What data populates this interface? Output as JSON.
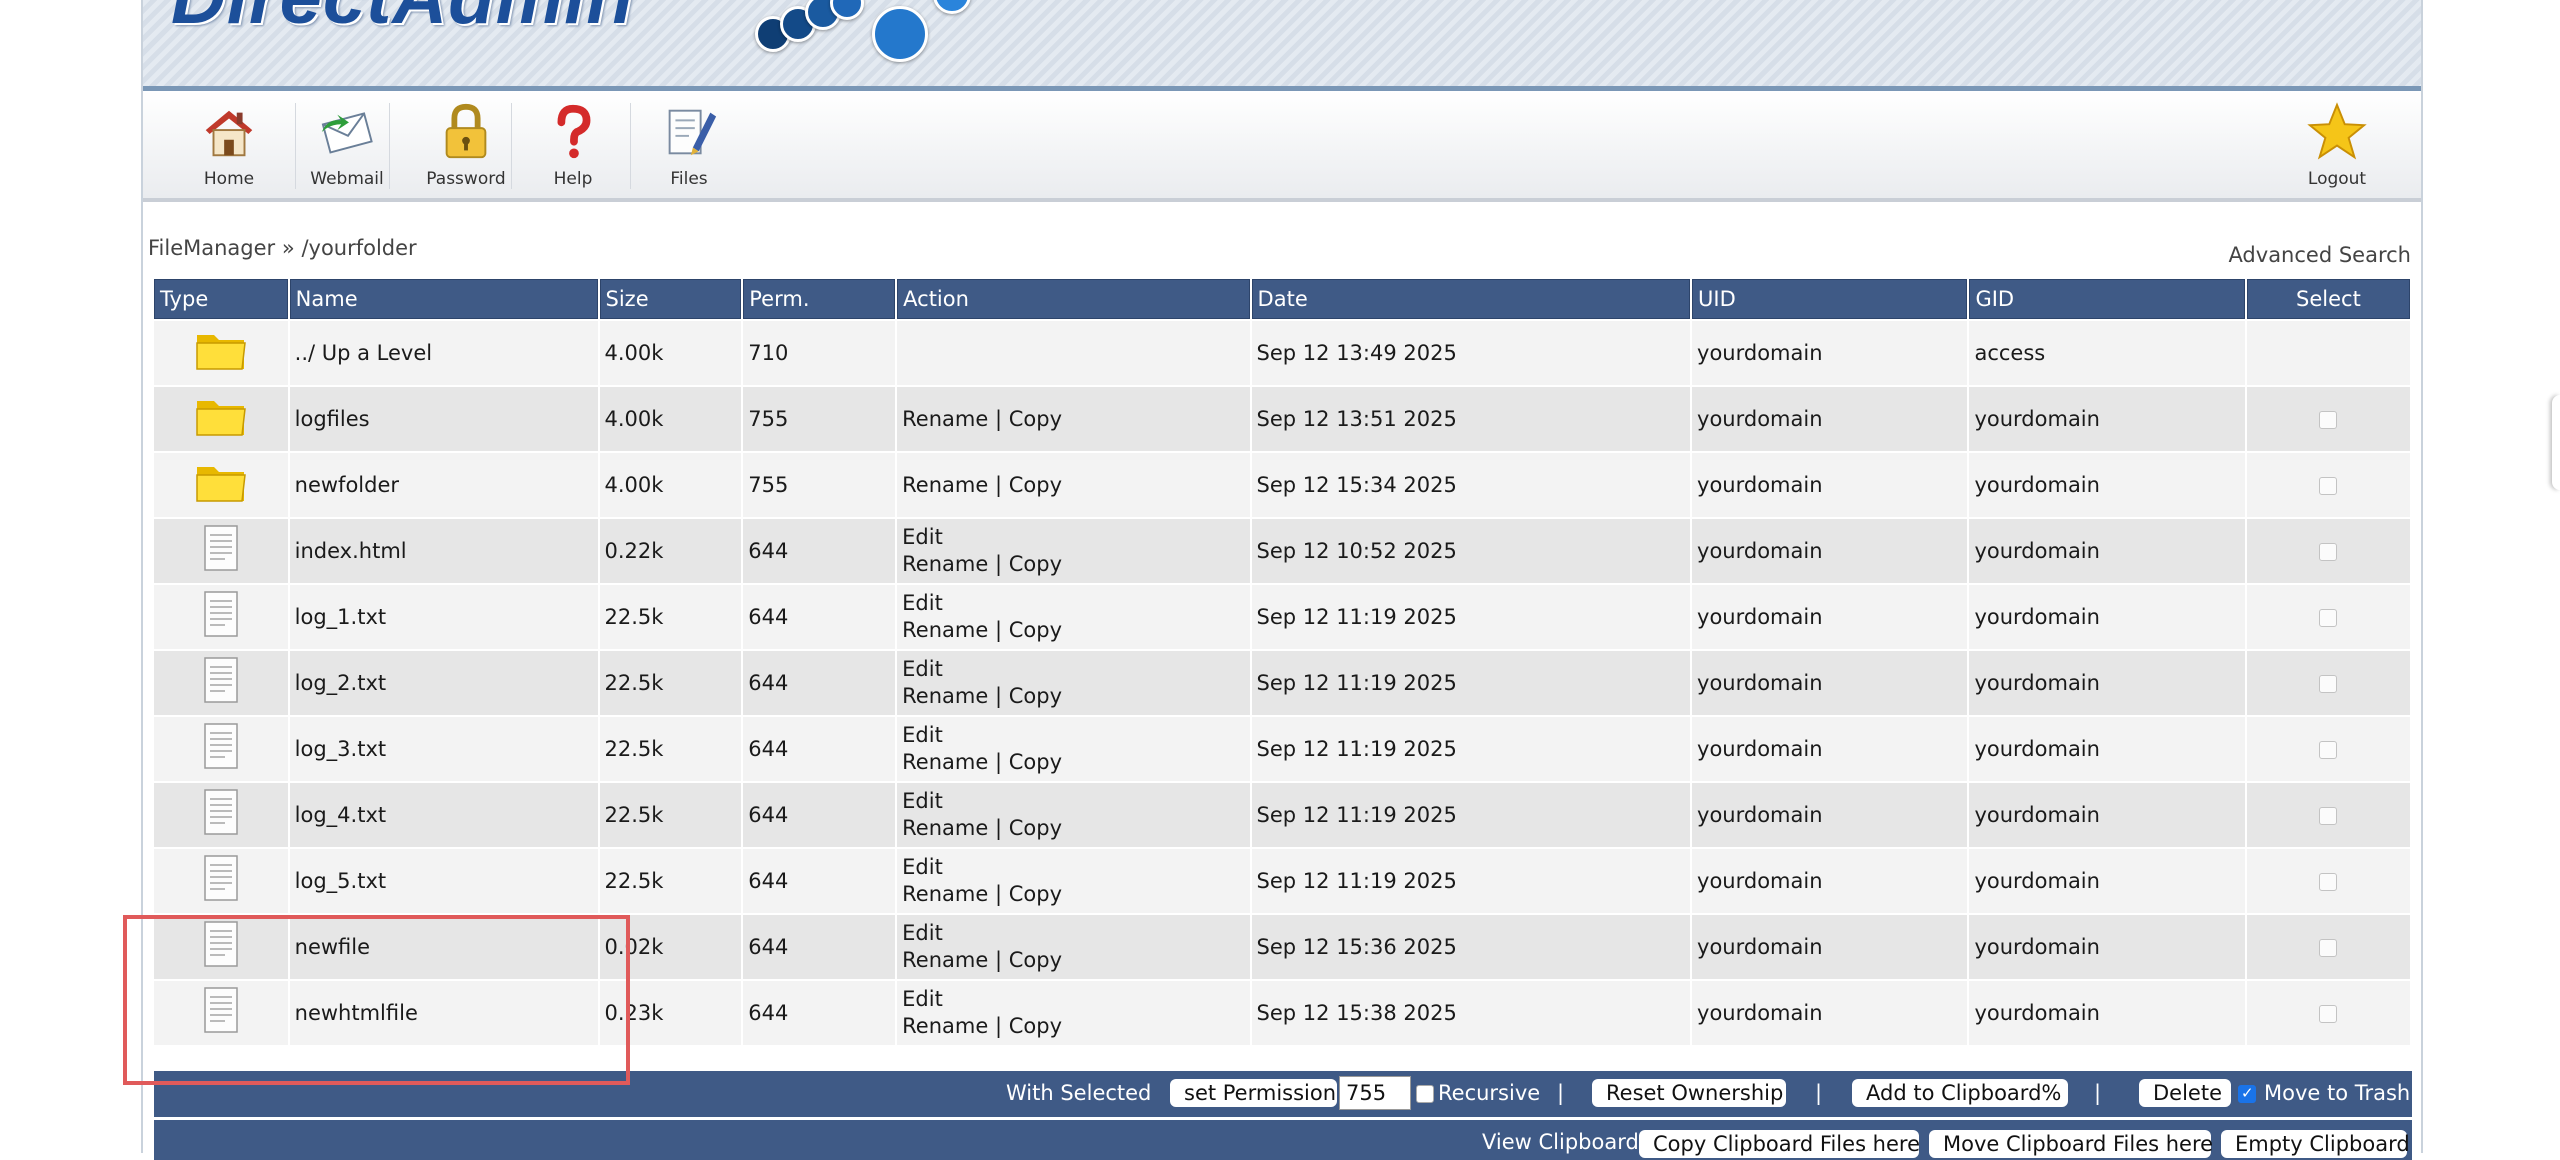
{
  "brand": {
    "logo_text": "DirectAdmin"
  },
  "toolbar": {
    "items": [
      {
        "label": "Home",
        "icon": "house-icon"
      },
      {
        "label": "Webmail",
        "icon": "envelope-icon"
      },
      {
        "label": "Password",
        "icon": "padlock-icon"
      },
      {
        "label": "Help",
        "icon": "question-mark-icon"
      },
      {
        "label": "Files",
        "icon": "document-pen-icon"
      }
    ],
    "logout_label": "Logout"
  },
  "breadcrumb": {
    "root": "FileManager",
    "separator": "»",
    "path": "/yourfolder"
  },
  "advanced_search": "Advanced Search",
  "table": {
    "headers": [
      "Type",
      "Name",
      "Size",
      "Perm.",
      "Action",
      "Date",
      "UID",
      "GID",
      "Select"
    ],
    "rows": [
      {
        "type": "folder",
        "name": "../ Up a Level",
        "size": "4.00k",
        "perm": "710",
        "edit": "",
        "rename": "",
        "copy": "",
        "date": "Sep 12 13:49 2025",
        "uid": "yourdomain",
        "gid": "access",
        "selectable": false
      },
      {
        "type": "folder",
        "name": "logfiles",
        "size": "4.00k",
        "perm": "755",
        "edit": "",
        "rename": "Rename",
        "copy": "Copy",
        "date": "Sep 12 13:51 2025",
        "uid": "yourdomain",
        "gid": "yourdomain",
        "selectable": true
      },
      {
        "type": "folder",
        "name": "newfolder",
        "size": "4.00k",
        "perm": "755",
        "edit": "",
        "rename": "Rename",
        "copy": "Copy",
        "date": "Sep 12 15:34 2025",
        "uid": "yourdomain",
        "gid": "yourdomain",
        "selectable": true
      },
      {
        "type": "file",
        "name": "index.html",
        "size": "0.22k",
        "perm": "644",
        "edit": "Edit",
        "rename": "Rename",
        "copy": "Copy",
        "date": "Sep 12 10:52 2025",
        "uid": "yourdomain",
        "gid": "yourdomain",
        "selectable": true
      },
      {
        "type": "file",
        "name": "log_1.txt",
        "size": "22.5k",
        "perm": "644",
        "edit": "Edit",
        "rename": "Rename",
        "copy": "Copy",
        "date": "Sep 12 11:19 2025",
        "uid": "yourdomain",
        "gid": "yourdomain",
        "selectable": true
      },
      {
        "type": "file",
        "name": "log_2.txt",
        "size": "22.5k",
        "perm": "644",
        "edit": "Edit",
        "rename": "Rename",
        "copy": "Copy",
        "date": "Sep 12 11:19 2025",
        "uid": "yourdomain",
        "gid": "yourdomain",
        "selectable": true
      },
      {
        "type": "file",
        "name": "log_3.txt",
        "size": "22.5k",
        "perm": "644",
        "edit": "Edit",
        "rename": "Rename",
        "copy": "Copy",
        "date": "Sep 12 11:19 2025",
        "uid": "yourdomain",
        "gid": "yourdomain",
        "selectable": true
      },
      {
        "type": "file",
        "name": "log_4.txt",
        "size": "22.5k",
        "perm": "644",
        "edit": "Edit",
        "rename": "Rename",
        "copy": "Copy",
        "date": "Sep 12 11:19 2025",
        "uid": "yourdomain",
        "gid": "yourdomain",
        "selectable": true
      },
      {
        "type": "file",
        "name": "log_5.txt",
        "size": "22.5k",
        "perm": "644",
        "edit": "Edit",
        "rename": "Rename",
        "copy": "Copy",
        "date": "Sep 12 11:19 2025",
        "uid": "yourdomain",
        "gid": "yourdomain",
        "selectable": true
      },
      {
        "type": "file",
        "name": "newfile",
        "size": "0.02k",
        "perm": "644",
        "edit": "Edit",
        "rename": "Rename",
        "copy": "Copy",
        "date": "Sep 12 15:36 2025",
        "uid": "yourdomain",
        "gid": "yourdomain",
        "selectable": true
      },
      {
        "type": "file",
        "name": "newhtmlfile",
        "size": "0.23k",
        "perm": "644",
        "edit": "Edit",
        "rename": "Rename",
        "copy": "Copy",
        "date": "Sep 12 15:38 2025",
        "uid": "yourdomain",
        "gid": "yourdomain",
        "selectable": true
      }
    ]
  },
  "actions": {
    "with_selected": "With Selected",
    "set_permission": "set Permission",
    "permission_value": "755",
    "recursive": "Recursive",
    "recursive_checked": false,
    "reset_ownership": "Reset Ownership",
    "add_to_clipboard": "Add to Clipboard%",
    "delete": "Delete",
    "move_to_trash": "Move to Trash",
    "move_to_trash_checked": true,
    "separator": "|"
  },
  "clipboard": {
    "view": "View Clipboard",
    "copy_here": "Copy Clipboard Files here",
    "move_here": "Move Clipboard Files here",
    "empty": "Empty Clipboard"
  },
  "colors": {
    "header_bg": "#3f5a86",
    "highlight": "#e05a5a",
    "check_accent": "#1a73e8"
  }
}
